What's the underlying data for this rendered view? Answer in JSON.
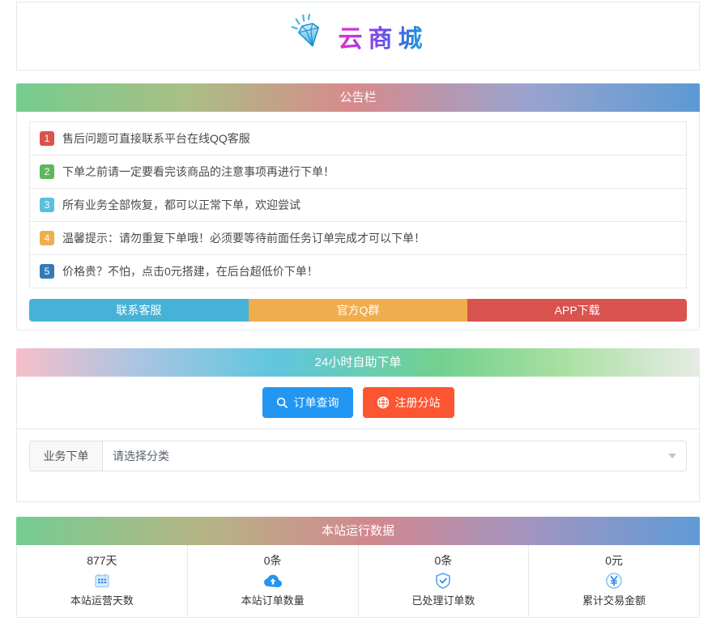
{
  "logo": {
    "title": "云商城"
  },
  "announcement": {
    "header": "公告栏",
    "items": [
      {
        "num": "1",
        "color": "#d9534f",
        "text": "售后问题可直接联系平台在线QQ客服"
      },
      {
        "num": "2",
        "color": "#5cb85c",
        "text": "下单之前请一定要看完该商品的注意事项再进行下单！"
      },
      {
        "num": "3",
        "color": "#5bc0de",
        "text": "所有业务全部恢复，都可以正常下单，欢迎尝试"
      },
      {
        "num": "4",
        "color": "#f0ad4e",
        "text": "温馨提示：请勿重复下单哦！必须要等待前面任务订单完成才可以下单！"
      },
      {
        "num": "5",
        "color": "#337ab7",
        "text": "价格贵？不怕，点击0元搭建，在后台超低价下单！"
      }
    ],
    "buttons": [
      {
        "label": "联系客服",
        "color": "#47b2d8"
      },
      {
        "label": "官方Q群",
        "color": "#f0ad4e"
      },
      {
        "label": "APP下载",
        "color": "#d9534f"
      }
    ]
  },
  "order": {
    "header": "24小时自助下单",
    "buttons": [
      {
        "label": "订单查询",
        "icon": "search-icon",
        "color": "#2196f3"
      },
      {
        "label": "注册分站",
        "icon": "globe-icon",
        "color": "#fc5531"
      }
    ],
    "form": {
      "label": "业务下单",
      "placeholder": "请选择分类"
    }
  },
  "stats": {
    "header": "本站运行数据",
    "items": [
      {
        "value": "877天",
        "label": "本站运营天数",
        "icon": "calendar-icon"
      },
      {
        "value": "0条",
        "label": "本站订单数量",
        "icon": "cloud-upload-icon"
      },
      {
        "value": "0条",
        "label": "已处理订单数",
        "icon": "shield-check-icon"
      },
      {
        "value": "0元",
        "label": "累计交易金额",
        "icon": "yen-circle-icon"
      }
    ],
    "icon_color": "#2b8df0"
  }
}
